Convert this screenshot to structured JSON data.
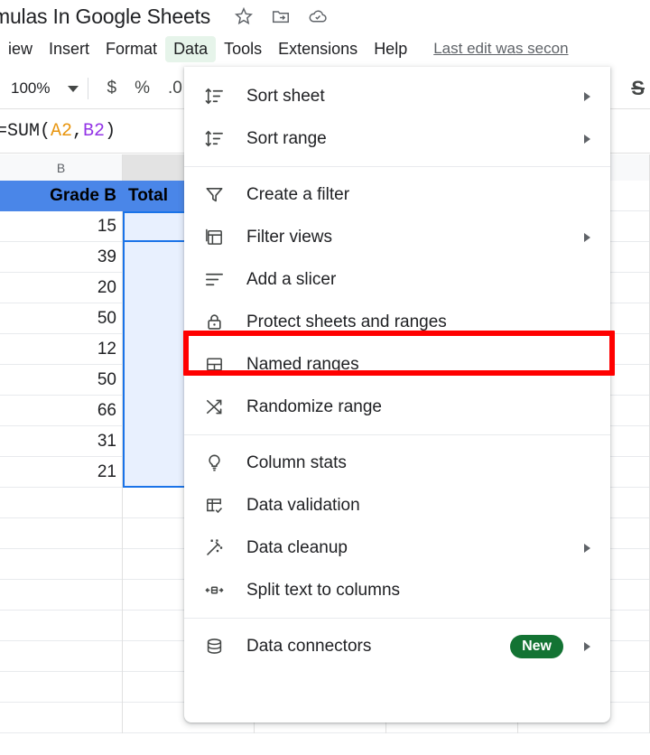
{
  "titlebar": {
    "doc_title": "mulas In Google Sheets",
    "icons": [
      {
        "name": "star-icon",
        "label": "Star"
      },
      {
        "name": "move-to-folder-icon",
        "label": "Move"
      },
      {
        "name": "cloud-saved-icon",
        "label": "Saved to Drive"
      }
    ]
  },
  "menubar": {
    "items": [
      {
        "label": "iew",
        "active": false
      },
      {
        "label": "Insert",
        "active": false
      },
      {
        "label": "Format",
        "active": false
      },
      {
        "label": "Data",
        "active": true
      },
      {
        "label": "Tools",
        "active": false
      },
      {
        "label": "Extensions",
        "active": false
      },
      {
        "label": "Help",
        "active": false
      }
    ],
    "last_edit": "Last edit was secon"
  },
  "toolbar": {
    "zoom_value": "100%",
    "currency_label": "$",
    "percent_label": "%",
    "decimal_label": ".0",
    "strikethrough_label": "S"
  },
  "formulabar": {
    "formula_prefix": "=SUM(",
    "ref_a": "A2",
    "comma": ",",
    "ref_b": "B2",
    "formula_suffix": ")"
  },
  "sheet": {
    "column_headers": [
      "B",
      ""
    ],
    "header_row": [
      "Grade B",
      "Total"
    ],
    "grade_b_values": [
      "15",
      "39",
      "20",
      "50",
      "12",
      "50",
      "66",
      "31",
      "21"
    ],
    "total_values": [
      "",
      "",
      "",
      "",
      "",
      "",
      "",
      "",
      ""
    ],
    "selected_column_header": "",
    "accent_header_bg": "#4a86e8",
    "selection_fill": "#e8f0fe",
    "selection_border": "#1a73e8"
  },
  "data_menu": {
    "groups": [
      {
        "items": [
          {
            "label": "Sort sheet",
            "icon": "sort-sheet-icon",
            "arrow": true,
            "badge": null
          },
          {
            "label": "Sort range",
            "icon": "sort-range-icon",
            "arrow": true,
            "badge": null
          }
        ]
      },
      {
        "items": [
          {
            "label": "Create a filter",
            "icon": "filter-icon",
            "arrow": false,
            "badge": null
          },
          {
            "label": "Filter views",
            "icon": "filter-views-icon",
            "arrow": true,
            "badge": null
          },
          {
            "label": "Add a slicer",
            "icon": "slicer-icon",
            "arrow": false,
            "badge": null
          },
          {
            "label": "Protect sheets and ranges",
            "icon": "lock-icon",
            "arrow": false,
            "badge": null,
            "highlighted": true
          },
          {
            "label": "Named ranges",
            "icon": "named-ranges-icon",
            "arrow": false,
            "badge": null
          },
          {
            "label": "Randomize range",
            "icon": "randomize-icon",
            "arrow": false,
            "badge": null
          }
        ]
      },
      {
        "items": [
          {
            "label": "Column stats",
            "icon": "lightbulb-icon",
            "arrow": false,
            "badge": null
          },
          {
            "label": "Data validation",
            "icon": "data-validation-icon",
            "arrow": false,
            "badge": null
          },
          {
            "label": "Data cleanup",
            "icon": "data-cleanup-icon",
            "arrow": true,
            "badge": null
          },
          {
            "label": "Split text to columns",
            "icon": "split-text-icon",
            "arrow": false,
            "badge": null
          }
        ]
      },
      {
        "items": [
          {
            "label": "Data connectors",
            "icon": "database-icon",
            "arrow": true,
            "badge": "New"
          }
        ]
      }
    ],
    "highlight_color": "#ff0000"
  }
}
